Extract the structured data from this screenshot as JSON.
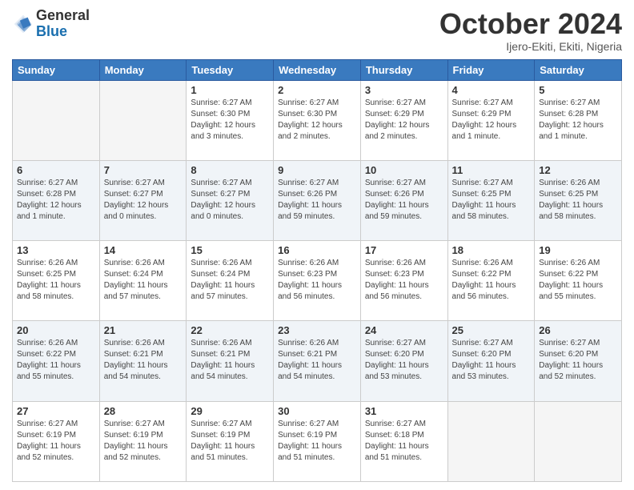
{
  "header": {
    "logo": {
      "general": "General",
      "blue": "Blue"
    },
    "title": "October 2024",
    "location": "Ijero-Ekiti, Ekiti, Nigeria"
  },
  "weekdays": [
    "Sunday",
    "Monday",
    "Tuesday",
    "Wednesday",
    "Thursday",
    "Friday",
    "Saturday"
  ],
  "weeks": [
    [
      {
        "day": "",
        "info": ""
      },
      {
        "day": "",
        "info": ""
      },
      {
        "day": "1",
        "info": "Sunrise: 6:27 AM\nSunset: 6:30 PM\nDaylight: 12 hours and 3 minutes."
      },
      {
        "day": "2",
        "info": "Sunrise: 6:27 AM\nSunset: 6:30 PM\nDaylight: 12 hours and 2 minutes."
      },
      {
        "day": "3",
        "info": "Sunrise: 6:27 AM\nSunset: 6:29 PM\nDaylight: 12 hours and 2 minutes."
      },
      {
        "day": "4",
        "info": "Sunrise: 6:27 AM\nSunset: 6:29 PM\nDaylight: 12 hours and 1 minute."
      },
      {
        "day": "5",
        "info": "Sunrise: 6:27 AM\nSunset: 6:28 PM\nDaylight: 12 hours and 1 minute."
      }
    ],
    [
      {
        "day": "6",
        "info": "Sunrise: 6:27 AM\nSunset: 6:28 PM\nDaylight: 12 hours and 1 minute."
      },
      {
        "day": "7",
        "info": "Sunrise: 6:27 AM\nSunset: 6:27 PM\nDaylight: 12 hours and 0 minutes."
      },
      {
        "day": "8",
        "info": "Sunrise: 6:27 AM\nSunset: 6:27 PM\nDaylight: 12 hours and 0 minutes."
      },
      {
        "day": "9",
        "info": "Sunrise: 6:27 AM\nSunset: 6:26 PM\nDaylight: 11 hours and 59 minutes."
      },
      {
        "day": "10",
        "info": "Sunrise: 6:27 AM\nSunset: 6:26 PM\nDaylight: 11 hours and 59 minutes."
      },
      {
        "day": "11",
        "info": "Sunrise: 6:27 AM\nSunset: 6:25 PM\nDaylight: 11 hours and 58 minutes."
      },
      {
        "day": "12",
        "info": "Sunrise: 6:26 AM\nSunset: 6:25 PM\nDaylight: 11 hours and 58 minutes."
      }
    ],
    [
      {
        "day": "13",
        "info": "Sunrise: 6:26 AM\nSunset: 6:25 PM\nDaylight: 11 hours and 58 minutes."
      },
      {
        "day": "14",
        "info": "Sunrise: 6:26 AM\nSunset: 6:24 PM\nDaylight: 11 hours and 57 minutes."
      },
      {
        "day": "15",
        "info": "Sunrise: 6:26 AM\nSunset: 6:24 PM\nDaylight: 11 hours and 57 minutes."
      },
      {
        "day": "16",
        "info": "Sunrise: 6:26 AM\nSunset: 6:23 PM\nDaylight: 11 hours and 56 minutes."
      },
      {
        "day": "17",
        "info": "Sunrise: 6:26 AM\nSunset: 6:23 PM\nDaylight: 11 hours and 56 minutes."
      },
      {
        "day": "18",
        "info": "Sunrise: 6:26 AM\nSunset: 6:22 PM\nDaylight: 11 hours and 56 minutes."
      },
      {
        "day": "19",
        "info": "Sunrise: 6:26 AM\nSunset: 6:22 PM\nDaylight: 11 hours and 55 minutes."
      }
    ],
    [
      {
        "day": "20",
        "info": "Sunrise: 6:26 AM\nSunset: 6:22 PM\nDaylight: 11 hours and 55 minutes."
      },
      {
        "day": "21",
        "info": "Sunrise: 6:26 AM\nSunset: 6:21 PM\nDaylight: 11 hours and 54 minutes."
      },
      {
        "day": "22",
        "info": "Sunrise: 6:26 AM\nSunset: 6:21 PM\nDaylight: 11 hours and 54 minutes."
      },
      {
        "day": "23",
        "info": "Sunrise: 6:26 AM\nSunset: 6:21 PM\nDaylight: 11 hours and 54 minutes."
      },
      {
        "day": "24",
        "info": "Sunrise: 6:27 AM\nSunset: 6:20 PM\nDaylight: 11 hours and 53 minutes."
      },
      {
        "day": "25",
        "info": "Sunrise: 6:27 AM\nSunset: 6:20 PM\nDaylight: 11 hours and 53 minutes."
      },
      {
        "day": "26",
        "info": "Sunrise: 6:27 AM\nSunset: 6:20 PM\nDaylight: 11 hours and 52 minutes."
      }
    ],
    [
      {
        "day": "27",
        "info": "Sunrise: 6:27 AM\nSunset: 6:19 PM\nDaylight: 11 hours and 52 minutes."
      },
      {
        "day": "28",
        "info": "Sunrise: 6:27 AM\nSunset: 6:19 PM\nDaylight: 11 hours and 52 minutes."
      },
      {
        "day": "29",
        "info": "Sunrise: 6:27 AM\nSunset: 6:19 PM\nDaylight: 11 hours and 51 minutes."
      },
      {
        "day": "30",
        "info": "Sunrise: 6:27 AM\nSunset: 6:19 PM\nDaylight: 11 hours and 51 minutes."
      },
      {
        "day": "31",
        "info": "Sunrise: 6:27 AM\nSunset: 6:18 PM\nDaylight: 11 hours and 51 minutes."
      },
      {
        "day": "",
        "info": ""
      },
      {
        "day": "",
        "info": ""
      }
    ]
  ]
}
